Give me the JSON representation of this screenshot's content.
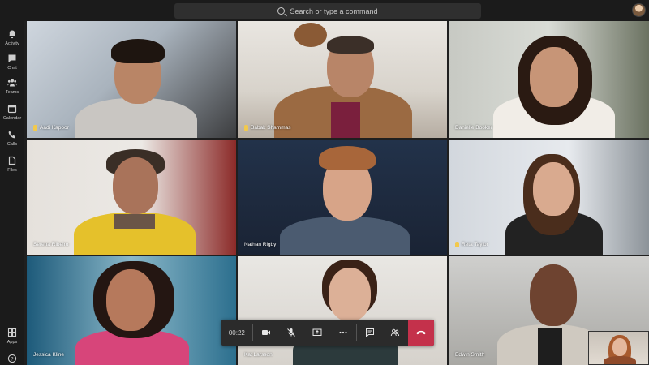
{
  "search": {
    "placeholder": "Search or type a command"
  },
  "rail": {
    "top_items": [
      {
        "label": "Activity",
        "icon": "bell-icon"
      },
      {
        "label": "Chat",
        "icon": "chat-icon"
      },
      {
        "label": "Teams",
        "icon": "teams-icon"
      },
      {
        "label": "Calendar",
        "icon": "calendar-icon"
      },
      {
        "label": "Calls",
        "icon": "phone-icon"
      },
      {
        "label": "Files",
        "icon": "files-icon"
      }
    ],
    "bottom_items": [
      {
        "label": "Apps",
        "icon": "apps-icon"
      },
      {
        "label": "",
        "icon": "help-icon"
      }
    ]
  },
  "participants": [
    {
      "name": "Aadi Kapoor",
      "hand_raised": true
    },
    {
      "name": "Babak Shammas",
      "hand_raised": true
    },
    {
      "name": "Danielle Booker",
      "hand_raised": false
    },
    {
      "name": "Serena Ribeiro",
      "hand_raised": false
    },
    {
      "name": "Nathan Rigby",
      "hand_raised": false
    },
    {
      "name": "Reta Taylor",
      "hand_raised": true
    },
    {
      "name": "Jessica Kline",
      "hand_raised": false
    },
    {
      "name": "Kat Larsson",
      "hand_raised": false
    },
    {
      "name": "Edwin Smith",
      "hand_raised": false
    }
  ],
  "call_controls": {
    "timer": "00:22",
    "buttons": [
      "camera-icon",
      "mic-off-icon",
      "share-screen-icon",
      "more-icon",
      "chat-icon",
      "participants-icon"
    ],
    "hangup_color": "#c4314b"
  },
  "colors": {
    "accent": "#c4314b",
    "hand": "#f2c94c"
  }
}
